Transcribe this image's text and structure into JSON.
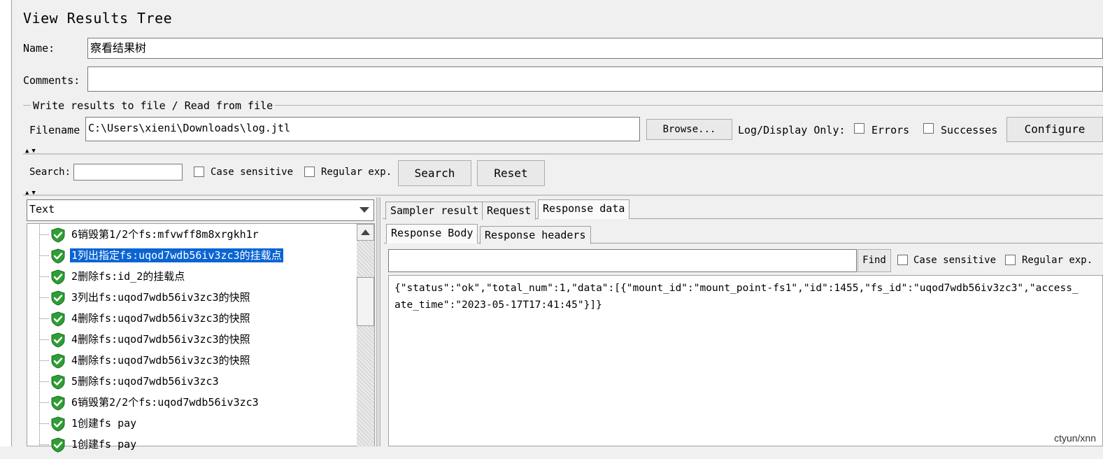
{
  "panel": {
    "title": "View Results Tree",
    "name_label": "Name:",
    "name_value": "察看结果树",
    "comments_label": "Comments:",
    "comments_value": ""
  },
  "file_group": {
    "legend": "Write results to file / Read from file",
    "filename_label": "Filename",
    "filename_value": "C:\\Users\\xieni\\Downloads\\log.jtl",
    "browse_label": "Browse...",
    "log_display_label": "Log/Display Only:",
    "errors_label": "Errors",
    "successes_label": "Successes",
    "configure_label": "Configure"
  },
  "search": {
    "label": "Search:",
    "value": "",
    "case_sensitive_label": "Case sensitive",
    "regex_label": "Regular exp.",
    "search_button": "Search",
    "reset_button": "Reset"
  },
  "renderer": {
    "selected": "Text"
  },
  "tree": {
    "items": [
      {
        "label": "6销毁第1/2个fs:mfvwff8m8xrgkh1r"
      },
      {
        "label": "1列出指定fs:uqod7wdb56iv3zc3的挂载点"
      },
      {
        "label": "2删除fs:id_2的挂载点"
      },
      {
        "label": "3列出fs:uqod7wdb56iv3zc3的快照"
      },
      {
        "label": "4删除fs:uqod7wdb56iv3zc3的快照"
      },
      {
        "label": "4删除fs:uqod7wdb56iv3zc3的快照"
      },
      {
        "label": "4删除fs:uqod7wdb56iv3zc3的快照"
      },
      {
        "label": "5删除fs:uqod7wdb56iv3zc3"
      },
      {
        "label": "6销毁第2/2个fs:uqod7wdb56iv3zc3"
      },
      {
        "label": "1创建fs pay"
      },
      {
        "label": "1创建fs pay"
      }
    ]
  },
  "result_tabs": {
    "sampler_result": "Sampler result",
    "request": "Request",
    "response_data": "Response data"
  },
  "response_tabs": {
    "body": "Response Body",
    "headers": "Response headers"
  },
  "find": {
    "value": "",
    "find_button": "Find",
    "case_sensitive_label": "Case sensitive",
    "regex_label": "Regular exp."
  },
  "response": {
    "line1": "{\"status\":\"ok\",\"total_num\":1,\"data\":[{\"mount_id\":\"mount_point-fs1\",\"id\":1455,\"fs_id\":\"uqod7wdb56iv3zc3\",\"access_",
    "line2": "ate_time\":\"2023-05-17T17:41:45\"}]}"
  },
  "watermark": "ctyun/xnn",
  "colors": {
    "selection": "#0a64d2",
    "shield_green": "#2e9e35",
    "background": "#f0f0f0"
  }
}
